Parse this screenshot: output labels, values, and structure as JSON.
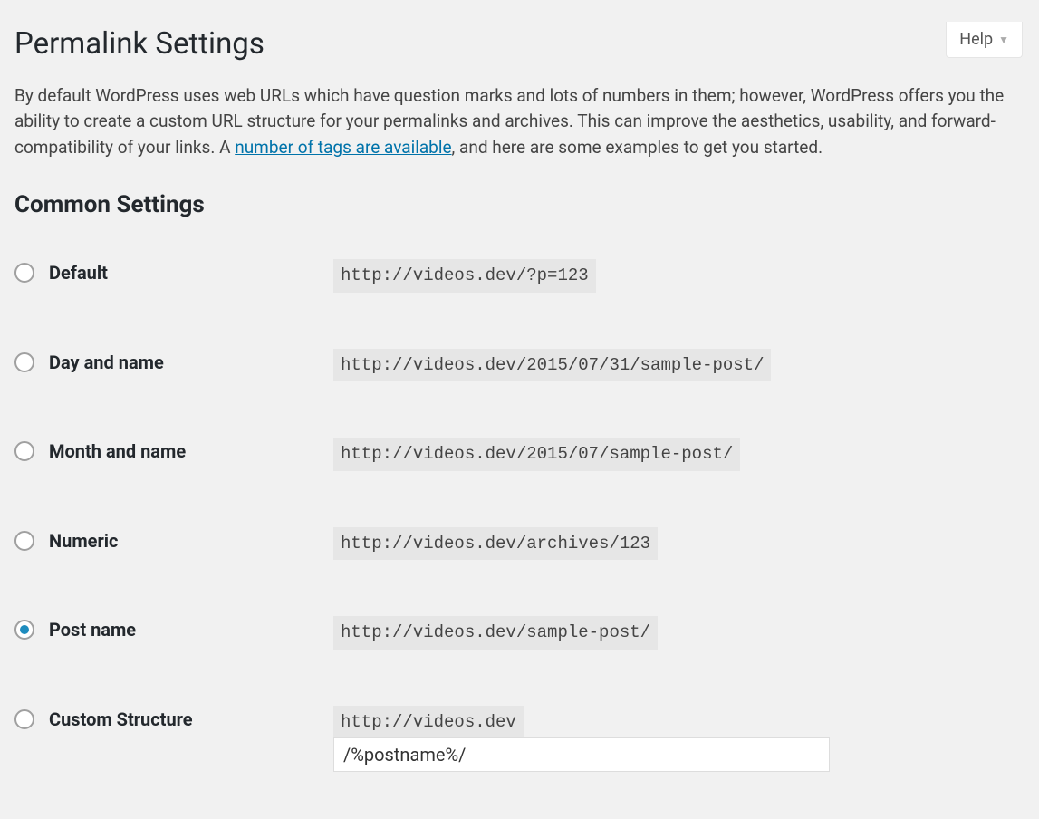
{
  "help": {
    "label": "Help"
  },
  "page": {
    "title": "Permalink Settings",
    "intro_before_link": "By default WordPress uses web URLs which have question marks and lots of numbers in them; however, WordPress offers you the ability to create a custom URL structure for your permalinks and archives. This can improve the aesthetics, usability, and forward-compatibility of your links. A ",
    "intro_link_text": "number of tags are available",
    "intro_after_link": ", and here are some examples to get you started."
  },
  "common_settings": {
    "heading": "Common Settings",
    "options": [
      {
        "label": "Default",
        "example": "http://videos.dev/?p=123",
        "checked": false
      },
      {
        "label": "Day and name",
        "example": "http://videos.dev/2015/07/31/sample-post/",
        "checked": false
      },
      {
        "label": "Month and name",
        "example": "http://videos.dev/2015/07/sample-post/",
        "checked": false
      },
      {
        "label": "Numeric",
        "example": "http://videos.dev/archives/123",
        "checked": false
      },
      {
        "label": "Post name",
        "example": "http://videos.dev/sample-post/",
        "checked": true
      }
    ],
    "custom": {
      "label": "Custom Structure",
      "base": "http://videos.dev",
      "value": "/%postname%/",
      "checked": false
    }
  }
}
